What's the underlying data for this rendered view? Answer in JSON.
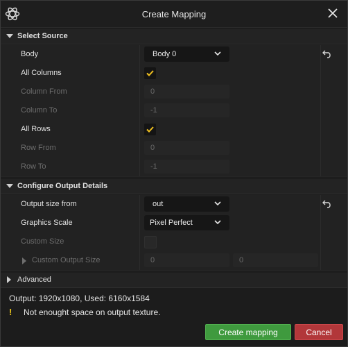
{
  "window": {
    "title": "Create Mapping"
  },
  "icons": {
    "logo": "atom-logo-icon",
    "close": "close-icon",
    "reset": "reset-arrow-icon",
    "warning": "warning-icon"
  },
  "select_source": {
    "title": "Select Source",
    "body": {
      "label": "Body",
      "value": "Body 0"
    },
    "all_columns": {
      "label": "All Columns",
      "checked": true
    },
    "column_from": {
      "label": "Column From",
      "value": "0"
    },
    "column_to": {
      "label": "Column To",
      "value": "-1"
    },
    "all_rows": {
      "label": "All Rows",
      "checked": true
    },
    "row_from": {
      "label": "Row From",
      "value": "0"
    },
    "row_to": {
      "label": "Row To",
      "value": "-1"
    }
  },
  "output_details": {
    "title": "Configure Output Details",
    "output_size_from": {
      "label": "Output size from",
      "value": "out"
    },
    "graphics_scale": {
      "label": "Graphics Scale",
      "value": "Pixel Perfect"
    },
    "custom_size": {
      "label": "Custom Size",
      "checked": false
    },
    "custom_output_size": {
      "label": "Custom Output Size",
      "width": "0",
      "height": "0"
    }
  },
  "advanced": {
    "title": "Advanced"
  },
  "status": {
    "output": "Output: 1920x1080, Used: 6160x1584",
    "warning_symbol": "!",
    "warning": "Not enought space on output texture."
  },
  "buttons": {
    "create": "Create mapping",
    "cancel": "Cancel"
  },
  "colors": {
    "accent_check": "#f0c020",
    "create_button": "#3f9a3e",
    "cancel_button": "#b2373a",
    "warning": "#e8c31a"
  }
}
